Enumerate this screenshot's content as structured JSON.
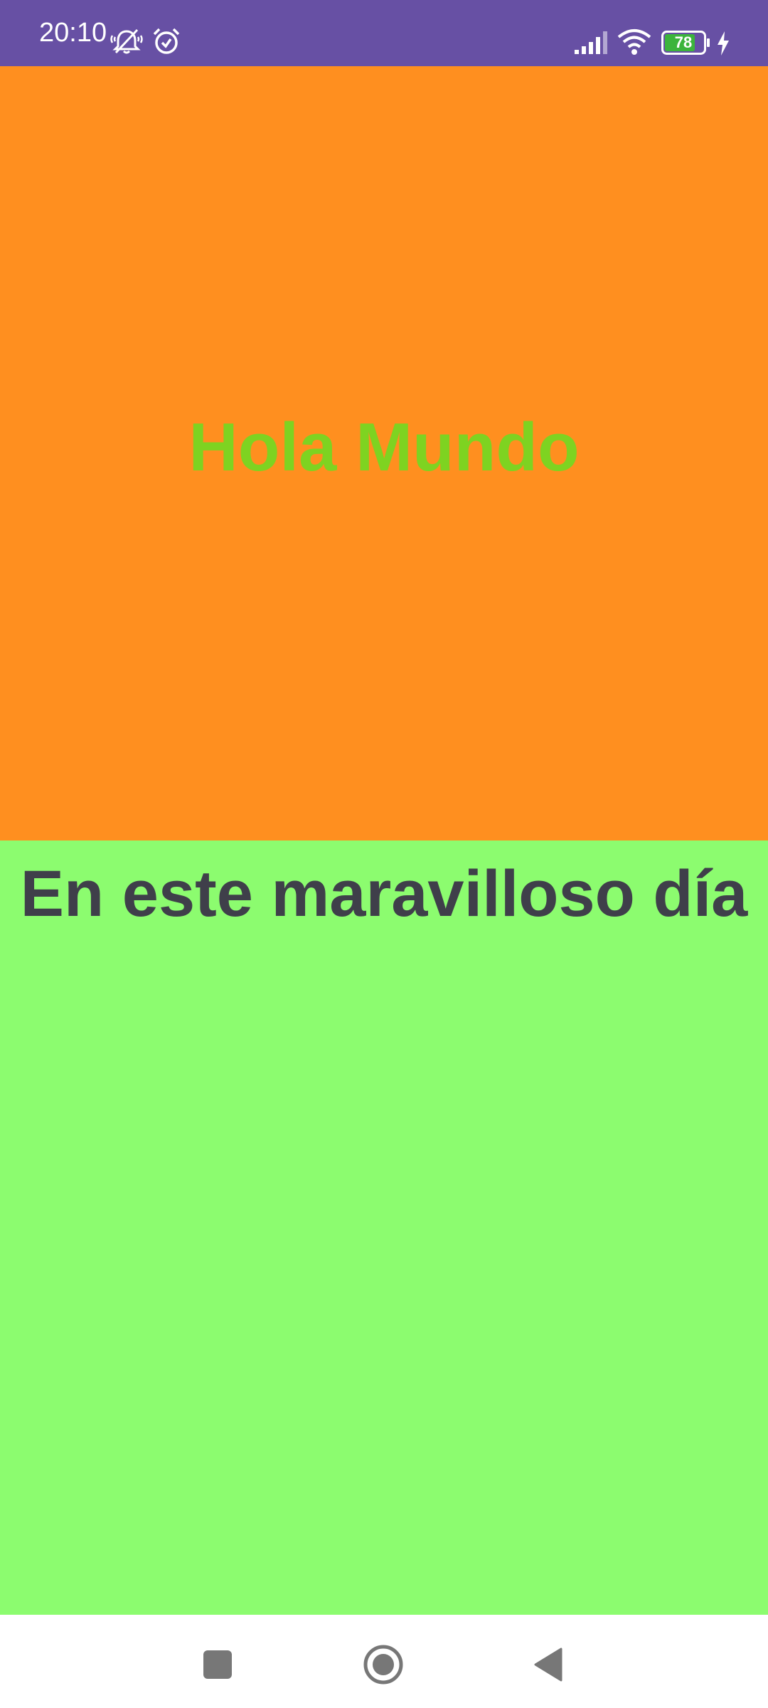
{
  "status_bar": {
    "time": "20:10",
    "battery_level": "78",
    "background_color": "#6750a4",
    "icons": [
      "mute-icon",
      "alarm-icon",
      "signal-icon",
      "wifi-icon",
      "battery-icon",
      "charging-icon"
    ]
  },
  "main": {
    "top_panel": {
      "text": "Hola Mundo",
      "background_color": "#ff8f1f",
      "text_color": "#7ed321"
    },
    "bottom_panel": {
      "text": "En este maravilloso día",
      "background_color": "#8cfc6f",
      "text_color": "#3f3f4a"
    }
  },
  "nav_bar": {
    "buttons": [
      "recents-button",
      "home-button",
      "back-button"
    ]
  }
}
